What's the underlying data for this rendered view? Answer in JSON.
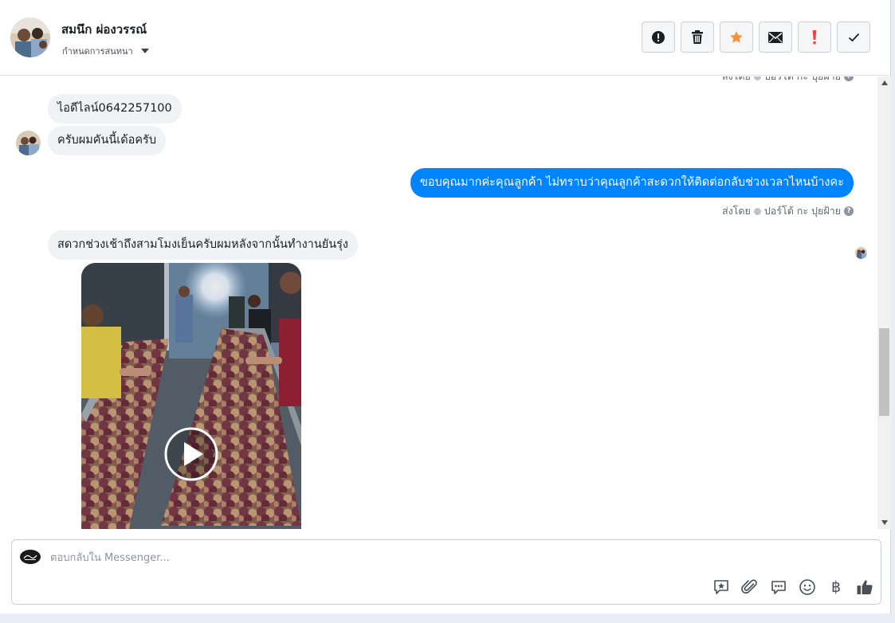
{
  "header": {
    "contact_name": "สมนึก ผ่องวรรณ์",
    "assign_label": "กำหนดการสนทนา",
    "actions": [
      {
        "name": "report-spam",
        "icon": "exclamation-circle-icon"
      },
      {
        "name": "delete",
        "icon": "trash-icon"
      },
      {
        "name": "star",
        "icon": "star-icon",
        "color": "#f7923b"
      },
      {
        "name": "mark-unread",
        "icon": "envelope-icon"
      },
      {
        "name": "flag-important",
        "icon": "exclamation-icon",
        "color": "#fa3e3e"
      },
      {
        "name": "mark-done",
        "icon": "check-icon"
      }
    ]
  },
  "thread": {
    "sent_by_label": "ส่งโดย",
    "sender_name": "ปอร์โต้ กะ ปุยฝ้าย",
    "messages": [
      {
        "from": "customer",
        "text": "ไอดีไลน์0642257100"
      },
      {
        "from": "customer",
        "text": "ครับผมคันนี้เด้อครับ"
      },
      {
        "from": "page",
        "text": "ขอบคุณมากค่ะคุณลูกค้า ไม่ทราบว่าคุณลูกค้าสะดวกให้ติดต่อกลับช่วงเวลาไหนบ้างคะ"
      },
      {
        "from": "customer",
        "text": "สดวกช่วงเช้าถึงสามโมงเย็นครับผมหลังจากนั้นทำงานยันรุ่ง"
      },
      {
        "from": "customer",
        "type": "video",
        "icon": "play-icon"
      }
    ]
  },
  "composer": {
    "placeholder": "ตอบกลับใน Messenger...",
    "tools": [
      "saved-reply-icon",
      "attachment-icon",
      "quick-reply-icon",
      "emoji-icon",
      "baht-icon",
      "like-icon"
    ],
    "baht_glyph": "฿"
  },
  "colors": {
    "accent": "#0084ff",
    "incoming_bubble": "#f0f2f5",
    "star": "#f7923b",
    "flag": "#fa3e3e"
  }
}
